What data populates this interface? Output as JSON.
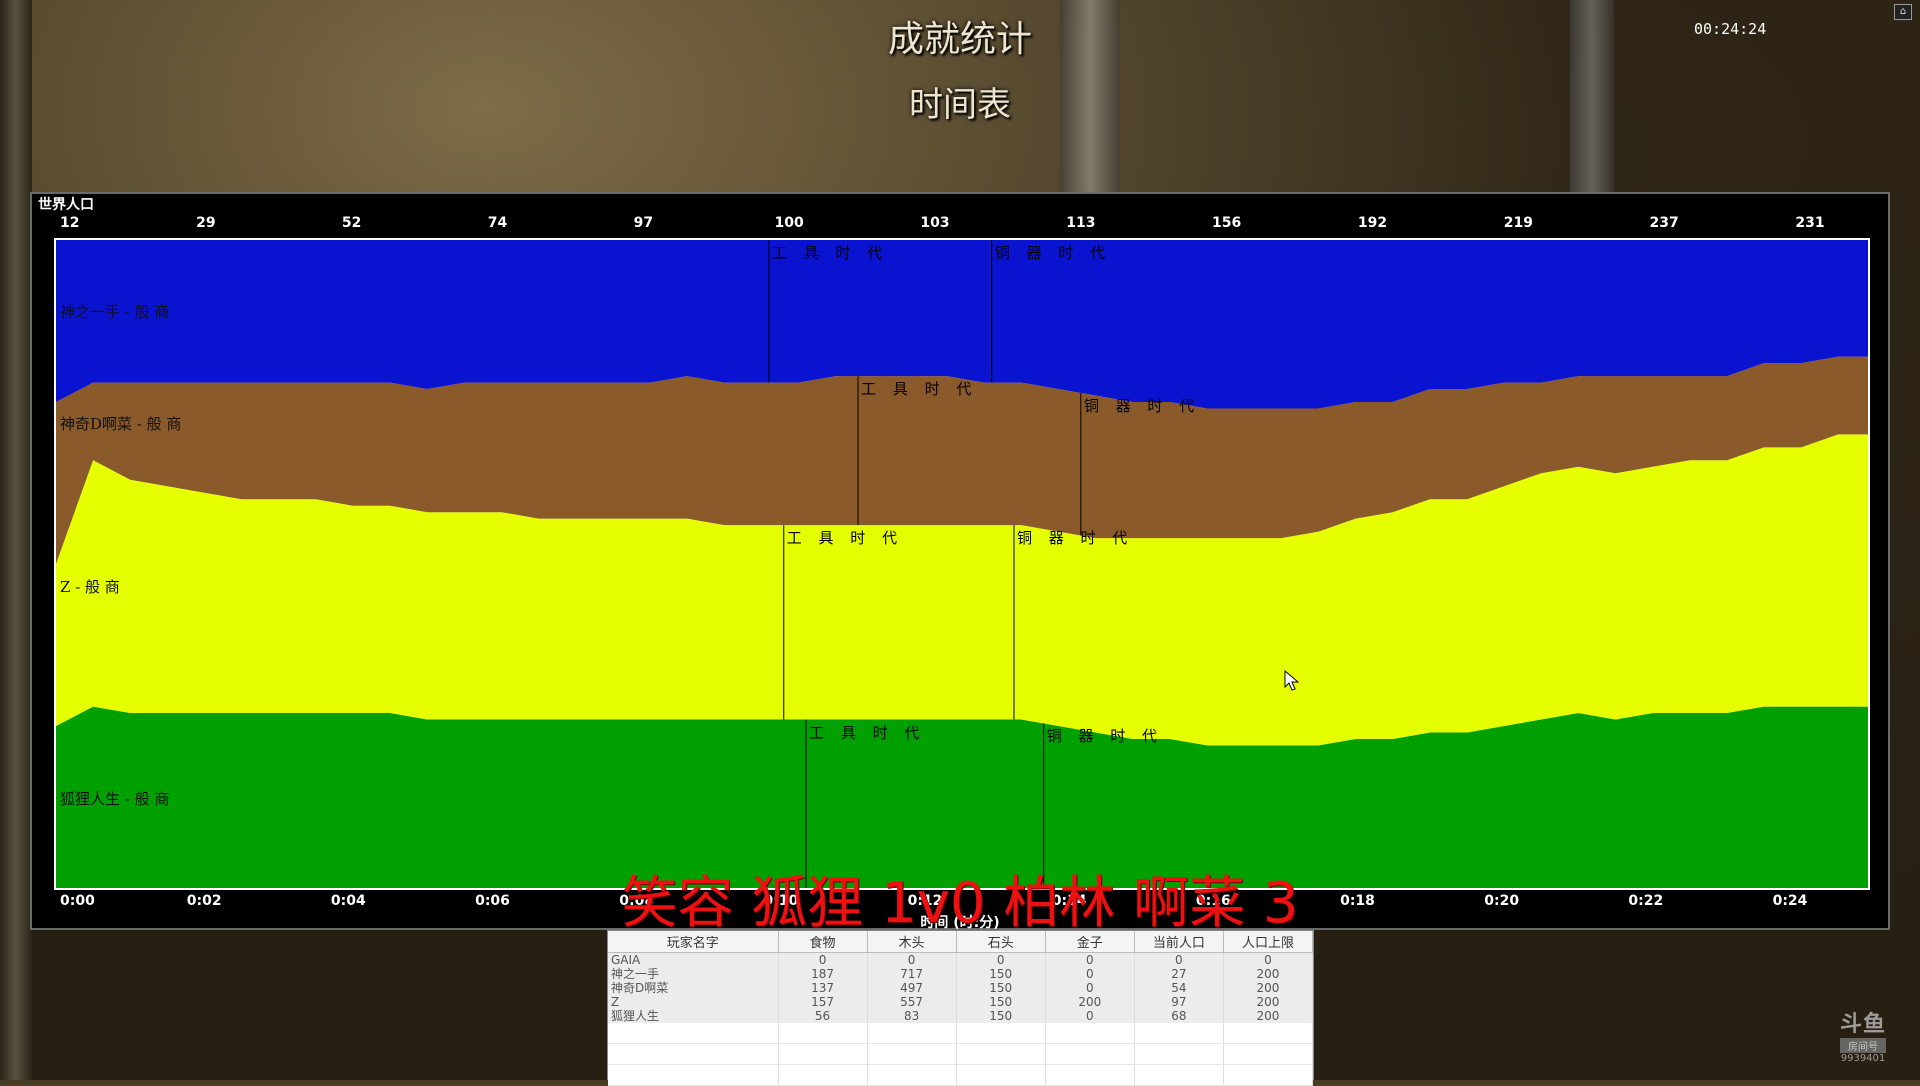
{
  "window": {
    "title": "成就统计",
    "subtitle": "时间表",
    "clock": "00:24:24"
  },
  "chart": {
    "label": "世界人口",
    "axis_title": "时间 (时:分)",
    "top_ticks": [
      "12",
      "29",
      "52",
      "74",
      "97",
      "100",
      "103",
      "113",
      "156",
      "192",
      "219",
      "237",
      "231"
    ],
    "bottom_ticks": [
      "0:00",
      "0:02",
      "0:04",
      "0:06",
      "0:08",
      "0:10",
      "0:12",
      "0:14",
      "0:16",
      "0:18",
      "0:20",
      "0:22",
      "0:24"
    ]
  },
  "chart_data": {
    "type": "area",
    "stacked": true,
    "normalized": true,
    "x": [
      0.0,
      0.5,
      1.0,
      1.5,
      2.0,
      2.5,
      3.0,
      3.5,
      4.0,
      4.5,
      5.0,
      5.5,
      6.0,
      6.5,
      7.0,
      7.5,
      8.0,
      8.5,
      9.0,
      9.5,
      10.0,
      10.5,
      11.0,
      11.5,
      12.0,
      12.5,
      13.0,
      13.5,
      14.0,
      14.5,
      15.0,
      15.5,
      16.0,
      16.5,
      17.0,
      17.5,
      18.0,
      18.5,
      19.0,
      19.5,
      20.0,
      20.5,
      21.0,
      21.5,
      22.0,
      22.5,
      23.0,
      23.5,
      24.0,
      24.4
    ],
    "series": [
      {
        "name": "狐狸人生 - 般 商",
        "color": "#00a000",
        "values": [
          0.25,
          0.28,
          0.27,
          0.27,
          0.27,
          0.27,
          0.27,
          0.27,
          0.27,
          0.27,
          0.26,
          0.26,
          0.26,
          0.26,
          0.26,
          0.26,
          0.26,
          0.26,
          0.26,
          0.26,
          0.26,
          0.26,
          0.26,
          0.26,
          0.26,
          0.26,
          0.26,
          0.25,
          0.24,
          0.23,
          0.23,
          0.22,
          0.22,
          0.22,
          0.22,
          0.23,
          0.23,
          0.24,
          0.24,
          0.25,
          0.26,
          0.27,
          0.26,
          0.27,
          0.27,
          0.27,
          0.28,
          0.28,
          0.28,
          0.28
        ]
      },
      {
        "name": "Z - 般 商",
        "color": "#e6ff00",
        "values": [
          0.25,
          0.38,
          0.36,
          0.35,
          0.34,
          0.33,
          0.33,
          0.33,
          0.32,
          0.32,
          0.32,
          0.32,
          0.32,
          0.31,
          0.31,
          0.31,
          0.31,
          0.31,
          0.3,
          0.3,
          0.3,
          0.3,
          0.3,
          0.3,
          0.3,
          0.3,
          0.3,
          0.3,
          0.3,
          0.31,
          0.31,
          0.32,
          0.32,
          0.32,
          0.33,
          0.34,
          0.35,
          0.36,
          0.36,
          0.37,
          0.38,
          0.38,
          0.38,
          0.38,
          0.39,
          0.39,
          0.4,
          0.4,
          0.42,
          0.42
        ]
      },
      {
        "name": "神奇D啊菜 - 般 商",
        "color": "#8b5a2b",
        "values": [
          0.25,
          0.12,
          0.15,
          0.16,
          0.17,
          0.18,
          0.18,
          0.18,
          0.19,
          0.19,
          0.19,
          0.2,
          0.2,
          0.21,
          0.21,
          0.21,
          0.21,
          0.22,
          0.22,
          0.22,
          0.22,
          0.23,
          0.23,
          0.23,
          0.23,
          0.22,
          0.22,
          0.22,
          0.22,
          0.21,
          0.21,
          0.2,
          0.2,
          0.2,
          0.19,
          0.18,
          0.17,
          0.17,
          0.17,
          0.16,
          0.14,
          0.14,
          0.15,
          0.14,
          0.13,
          0.13,
          0.13,
          0.13,
          0.12,
          0.12
        ]
      },
      {
        "name": "神之一手 - 般 商",
        "color": "#0a14d0",
        "values": [
          0.25,
          0.22,
          0.22,
          0.22,
          0.22,
          0.22,
          0.22,
          0.22,
          0.22,
          0.22,
          0.23,
          0.22,
          0.22,
          0.22,
          0.22,
          0.22,
          0.22,
          0.21,
          0.22,
          0.22,
          0.22,
          0.21,
          0.21,
          0.21,
          0.21,
          0.22,
          0.22,
          0.23,
          0.24,
          0.25,
          0.25,
          0.26,
          0.26,
          0.26,
          0.26,
          0.25,
          0.25,
          0.23,
          0.23,
          0.22,
          0.22,
          0.21,
          0.21,
          0.21,
          0.21,
          0.21,
          0.19,
          0.19,
          0.18,
          0.18
        ]
      }
    ],
    "age_events": [
      {
        "series_index": 3,
        "label": "工 具 时 代",
        "time": 9.6
      },
      {
        "series_index": 3,
        "label": "铜 器 时 代",
        "time": 12.6
      },
      {
        "series_index": 2,
        "label": "工 具 时 代",
        "time": 10.8
      },
      {
        "series_index": 2,
        "label": "铜 器 时 代",
        "time": 13.8
      },
      {
        "series_index": 1,
        "label": "工 具 时 代",
        "time": 9.8
      },
      {
        "series_index": 1,
        "label": "铜 器 时 代",
        "time": 12.9
      },
      {
        "series_index": 0,
        "label": "工 具 时 代",
        "time": 10.1
      },
      {
        "series_index": 0,
        "label": "铜 器 时 代",
        "time": 13.3
      }
    ],
    "xlabel": "时间 (时:分)",
    "xlim": [
      0,
      24.4
    ],
    "ylim": [
      0,
      1
    ]
  },
  "overlay": {
    "text": "笑容 狐狸 1v0 柏林 啊菜 3"
  },
  "stats_table": {
    "headers": [
      "玩家名字",
      "食物",
      "木头",
      "石头",
      "金子",
      "当前人口",
      "人口上限"
    ],
    "rows": [
      [
        "GAIA",
        "0",
        "0",
        "0",
        "0",
        "0",
        "0"
      ],
      [
        "神之一手",
        "187",
        "717",
        "150",
        "0",
        "27",
        "200"
      ],
      [
        "神奇D啊菜",
        "137",
        "497",
        "150",
        "0",
        "54",
        "200"
      ],
      [
        "Z",
        "157",
        "557",
        "150",
        "200",
        "97",
        "200"
      ],
      [
        "狐狸人生",
        "56",
        "83",
        "150",
        "0",
        "68",
        "200"
      ]
    ]
  },
  "watermark": {
    "logo": "斗鱼",
    "sub": "房间号",
    "room": "9939401"
  }
}
